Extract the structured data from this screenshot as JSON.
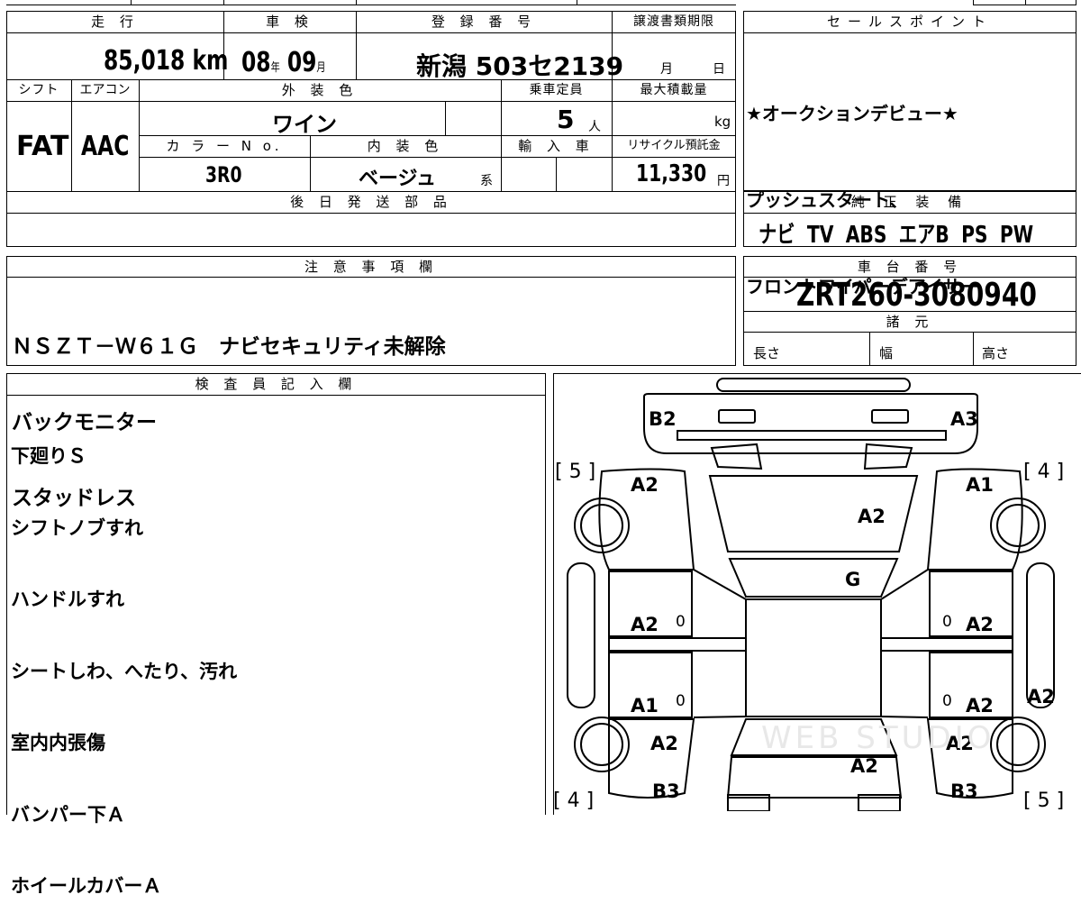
{
  "header": {
    "mileage_label": "走 行",
    "shaken_label": "車 検",
    "reg_number_label": "登 録 番 号",
    "transfer_deadline_label": "譲渡書類期限",
    "sales_point_label": "セールスポイント",
    "shift_label": "シフト",
    "aircon_label": "エアコン",
    "exterior_color_label": "外 装 色",
    "capacity_label": "乗車定員",
    "max_load_label": "最大積載量",
    "color_no_label": "カ ラ ー N o.",
    "interior_color_label": "内 装 色",
    "import_label": "輸 入 車",
    "recycle_label": "リサイクル預託金",
    "later_parts_label": "後 日 発 送 部 品",
    "factory_equipment_label": "純 正 装 備",
    "notes_label": "注 意 事 項 欄",
    "chassis_label": "車 台 番 号",
    "specs_label": "諸 元",
    "inspector_label": "検 査 員 記 入 欄"
  },
  "vehicle": {
    "mileage": "85,018",
    "mileage_unit": "km",
    "shaken_year": "08",
    "year_unit": "年",
    "shaken_month": "09",
    "month_unit": "月",
    "reg_number": "新潟 503セ2139",
    "deadline_month": "月",
    "deadline_day": "日",
    "shift": "FAT",
    "aircon": "AAC",
    "exterior_color": "ワイン",
    "capacity": "5",
    "capacity_unit": "人",
    "max_load_unit": "kg",
    "color_no": "3R0",
    "interior_color": "ベージュ",
    "interior_suffix": "系",
    "recycle_fee": "11,330",
    "recycle_unit": "円",
    "chassis_number": "ZRT260-3080940",
    "length_label": "長さ",
    "width_label": "幅",
    "height_label": "高さ"
  },
  "sales_points": [
    "★オークションデビュー★",
    "プッシュスタート、",
    "フロントワイパーデアイサー"
  ],
  "equipment": "ナビ TV ABS エアB PS PW",
  "notes": [
    "ＮＳＺＴ－Ｗ６１Ｇ　ナビセキュリティ未解除",
    "バックモニター",
    "スタッドレス"
  ],
  "inspector_notes": [
    "下廻りＳ",
    "シフトノブすれ",
    "ハンドルすれ",
    "シートしわ、へたり、汚れ",
    "室内内張傷",
    "バンパー下Ａ",
    "ホイールカバーＡ"
  ],
  "diagram": {
    "b2": "B2",
    "a3": "A3",
    "bracket_tl": "[ 5 ]",
    "bracket_tr": "[ 4 ]",
    "bracket_bl": "[ 4 ]",
    "bracket_br": "[ 5 ]",
    "left_front_fender": "A2",
    "right_front_fender": "A1",
    "hood": "A2",
    "windshield": "G",
    "left_front_door": "A2",
    "right_front_door": "A2",
    "left_rear_door": "A1",
    "right_rear_door": "A2",
    "right_quarter": "A2",
    "left_rear_fender": "A2",
    "right_rear_fender": "A2",
    "trunk": "A2",
    "b3_left": "B3",
    "b3_right": "B3",
    "zero": "0",
    "watermark": "WEB STUDIO"
  }
}
